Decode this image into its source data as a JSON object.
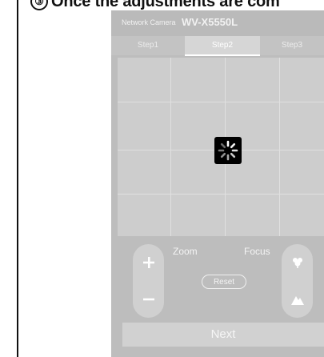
{
  "instruction": {
    "number": "③",
    "text": "Once the adjustments are com"
  },
  "camera_panel": {
    "title_prefix": "Network Camera",
    "model": "WV-X5550L",
    "tabs": [
      {
        "label": "Step1",
        "active": false
      },
      {
        "label": "Step2",
        "active": true
      },
      {
        "label": "Step3",
        "active": false
      }
    ],
    "preview": {
      "state": "loading",
      "grid_lines": "on",
      "spinner_icon": "loading-spinner-icon"
    },
    "controls": {
      "zoom_label": "Zoom",
      "focus_label": "Focus",
      "zoom_in_icon": "plus-icon",
      "zoom_out_icon": "minus-icon",
      "focus_near_icon": "flower-icon",
      "focus_far_icon": "mountain-icon",
      "reset_label": "Reset"
    },
    "next_label": "Next",
    "colors": {
      "panel_bg": "#bdbdbd",
      "text_light": "#f2f2f2",
      "spinner_bg": "#000000"
    }
  }
}
